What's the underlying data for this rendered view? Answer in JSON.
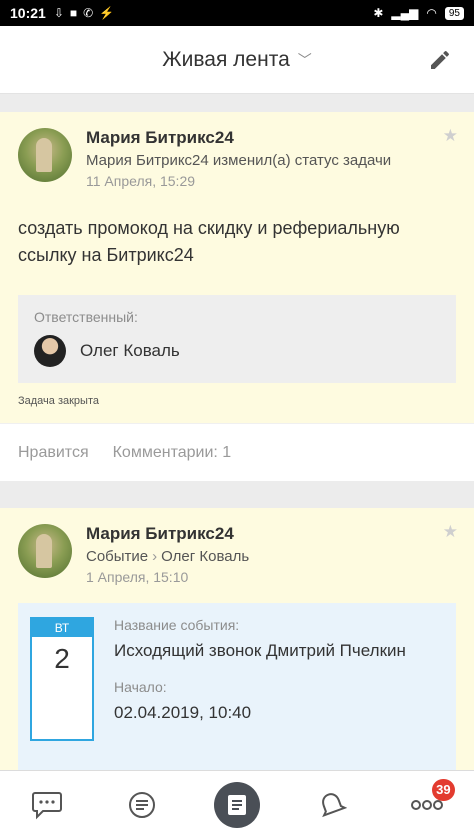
{
  "status_bar": {
    "time": "10:21",
    "battery": "95"
  },
  "header": {
    "title": "Живая лента"
  },
  "posts": [
    {
      "author": "Мария Битрикс24",
      "action": "Мария Битрикс24 изменил(а) статус задачи",
      "date": "11 Апреля, 15:29",
      "text": "создать промокод на скидку и рефериальную ссылку на Битрикс24",
      "responsible_label": "Ответственный:",
      "responsible_name": "Олег Коваль",
      "task_status": "Задача закрыта",
      "like_label": "Нравится",
      "comments_label": "Комментарии: 1"
    },
    {
      "author": "Мария Битрикс24",
      "type": "Событие",
      "recipient": "Олег Коваль",
      "date": "1 Апреля, 15:10",
      "calendar_weekday": "ВТ",
      "calendar_day": "2",
      "event_name_label": "Название события:",
      "event_name": "Исходящий звонок Дмитрий Пчелкин",
      "start_label": "Начало:",
      "start_value": "02.04.2019, 10:40"
    }
  ],
  "tabbar": {
    "badge_count": "39"
  }
}
